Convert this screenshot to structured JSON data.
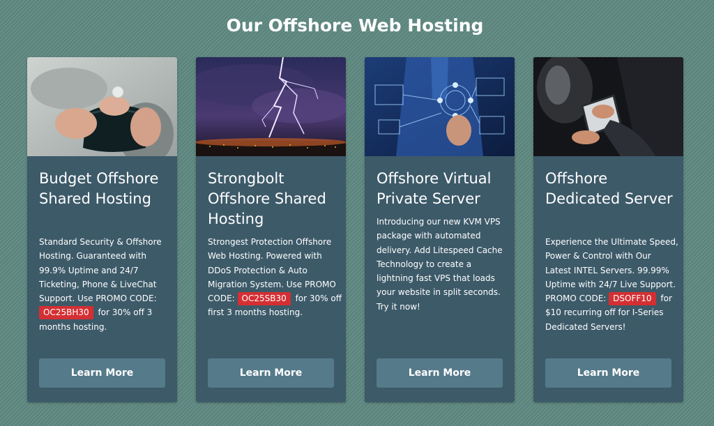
{
  "page": {
    "title": "Our Offshore Web Hosting"
  },
  "cards": [
    {
      "title": "Budget Offshore Shared Hosting",
      "description": "Standard Security & Offshore Hosting. Guaranteed with 99.9% Uptime and 24/7 Ticketing, Phone & LiveChat Support. Use PROMO CODE:",
      "promo_code": "OC25BH30",
      "description_after": "for 30% off 3 months hosting.",
      "button_label": "Learn More"
    },
    {
      "title": "Strongbolt Offshore Shared Hosting",
      "description": "Strongest Protection Offshore Web Hosting. Powered with DDoS Protection & Auto Migration System. Use PROMO CODE:",
      "promo_code": "OC25SB30",
      "description_after": "for 30% off first 3 months hosting.",
      "button_label": "Learn More"
    },
    {
      "title": "Offshore Virtual Private Server",
      "description": "Introducing our new KVM VPS package with automated delivery. Add Litespeed Cache Technology to create a lightning fast VPS that loads your website in split seconds. Try it now!",
      "button_label": "Learn More"
    },
    {
      "title": "Offshore Dedicated Server",
      "description": "Experience the Ultimate Speed, Power & Control with Our Latest INTEL Servers. 99.99% Uptime with 24/7 Live Support. PROMO CODE:",
      "promo_code": "DSOFF10",
      "description_after": "for $10 recurring off for I-Series Dedicated Servers!",
      "button_label": "Learn More"
    }
  ],
  "colors": {
    "background": "#5e8880",
    "card": "#3d5a69",
    "button": "#557a8a",
    "promo": "#d42f33"
  }
}
